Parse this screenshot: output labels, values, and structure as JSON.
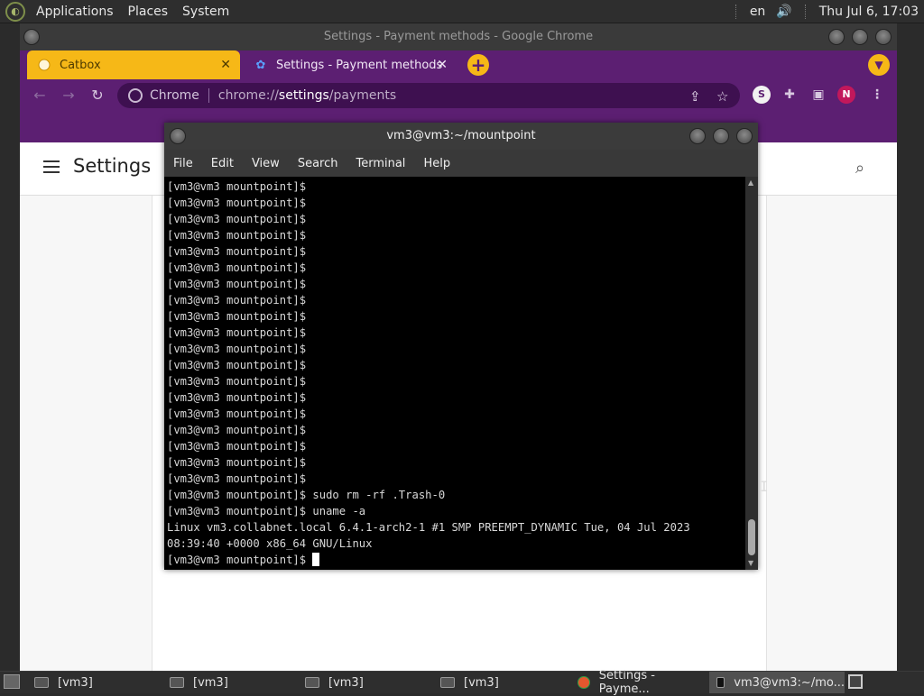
{
  "top_panel": {
    "menus": [
      "Applications",
      "Places",
      "System"
    ],
    "language": "en",
    "datetime": "Thu Jul  6, 17:03"
  },
  "chrome": {
    "window_title": "Settings - Payment methods - Google Chrome",
    "tabs": [
      {
        "label": "Catbox",
        "icon": "catbox-favicon"
      },
      {
        "label": "Settings - Payment methods",
        "icon": "gear-icon"
      }
    ],
    "close_glyph": "✕",
    "new_tab_glyph": "+",
    "omnibox": {
      "site_label": "Chrome",
      "url_prefix": "chrome://",
      "url_highlight": "settings",
      "url_suffix": "/payments"
    },
    "profile_initial": "N",
    "extension_initial": "S",
    "settings_title": "Settings",
    "accent_color": "#5c1f72",
    "tab_active_color": "#f6b817"
  },
  "terminal": {
    "title": "vm3@vm3:~/mountpoint",
    "menus": [
      "File",
      "Edit",
      "View",
      "Search",
      "Terminal",
      "Help"
    ],
    "lines": [
      "[vm3@vm3 mountpoint]$",
      "[vm3@vm3 mountpoint]$",
      "[vm3@vm3 mountpoint]$",
      "[vm3@vm3 mountpoint]$",
      "[vm3@vm3 mountpoint]$",
      "[vm3@vm3 mountpoint]$",
      "[vm3@vm3 mountpoint]$",
      "[vm3@vm3 mountpoint]$",
      "[vm3@vm3 mountpoint]$",
      "[vm3@vm3 mountpoint]$",
      "[vm3@vm3 mountpoint]$",
      "[vm3@vm3 mountpoint]$",
      "[vm3@vm3 mountpoint]$",
      "[vm3@vm3 mountpoint]$",
      "[vm3@vm3 mountpoint]$",
      "[vm3@vm3 mountpoint]$",
      "[vm3@vm3 mountpoint]$",
      "[vm3@vm3 mountpoint]$",
      "[vm3@vm3 mountpoint]$",
      "[vm3@vm3 mountpoint]$ sudo rm -rf .Trash-0",
      "[vm3@vm3 mountpoint]$ uname -a",
      "Linux vm3.collabnet.local 6.4.1-arch2-1 #1 SMP PREEMPT_DYNAMIC Tue, 04 Jul 2023",
      "08:39:40 +0000 x86_64 GNU/Linux"
    ],
    "prompt": "[vm3@vm3 mountpoint]$ "
  },
  "taskbar": {
    "items": [
      {
        "label": "[vm3]"
      },
      {
        "label": "[vm3]"
      },
      {
        "label": "[vm3]"
      },
      {
        "label": "[vm3]"
      },
      {
        "label": "Settings - Payme..."
      },
      {
        "label": "vm3@vm3:~/mo..."
      }
    ]
  }
}
